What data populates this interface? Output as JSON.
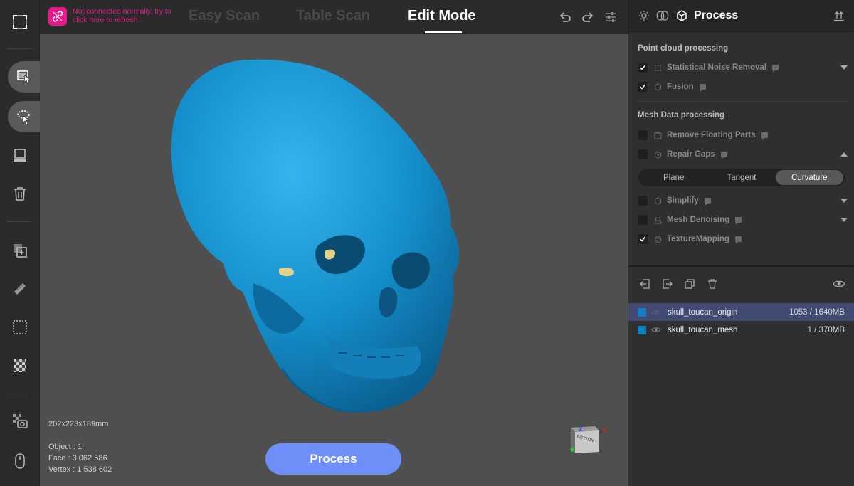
{
  "connection": {
    "message": "Not connected normally, try to click here to refresh."
  },
  "header": {
    "tabs": [
      {
        "label": "Easy Scan",
        "active": false
      },
      {
        "label": "Table Scan",
        "active": false
      },
      {
        "label": "Edit Mode",
        "active": true
      }
    ],
    "icons": [
      "undo-icon",
      "redo-icon",
      "sliders-icon"
    ]
  },
  "toolbar": {
    "tools": [
      "fit-view-icon",
      "select-icon",
      "lasso-select-icon",
      "screen-icon",
      "delete-icon",
      "merge-icon",
      "measure-icon",
      "crop-icon",
      "texture-icon",
      "snapshot-icon",
      "mouse-icon"
    ],
    "active": [
      "select-icon",
      "lasso-select-icon"
    ]
  },
  "viewport": {
    "dimensions": "202x223x189mm",
    "object": "Object : 1",
    "face": "Face : 3 062 586",
    "vertex": "Vertex : 1 538 602",
    "process_label": "Process",
    "navcube": {
      "z_label": "Z",
      "face_label": "BOTTOM",
      "x_label": "X"
    }
  },
  "panel": {
    "title": "Process",
    "point_cloud_title": "Point cloud processing",
    "point_cloud_items": [
      {
        "label": "Statistical Noise Removal",
        "checked": true,
        "expandable": true
      },
      {
        "label": "Fusion",
        "checked": true,
        "expandable": false
      }
    ],
    "mesh_title": "Mesh Data processing",
    "mesh_items": [
      {
        "label": "Remove Floating Parts",
        "checked": false
      },
      {
        "label": "Repair Gaps",
        "checked": false
      },
      {
        "label": "Simplify",
        "checked": false
      },
      {
        "label": "Mesh Denoising",
        "checked": false
      },
      {
        "label": "TextureMapping",
        "checked": true
      }
    ],
    "repair_modes": [
      {
        "label": "Plane",
        "active": false
      },
      {
        "label": "Tangent",
        "active": false
      },
      {
        "label": "Curvature",
        "active": true
      }
    ],
    "objects": [
      {
        "name": "skull_toucan_origin",
        "size": "1053 / 1640MB",
        "selected": true,
        "color": "#157fbd"
      },
      {
        "name": "skull_toucan_mesh",
        "size": "1 / 370MB",
        "selected": false,
        "color": "#157fbd"
      }
    ],
    "colors": {
      "accent": "#6f8ff8",
      "warning": "#e6198a",
      "model": "#1a8fcc",
      "selected_row": "#414a72"
    }
  }
}
